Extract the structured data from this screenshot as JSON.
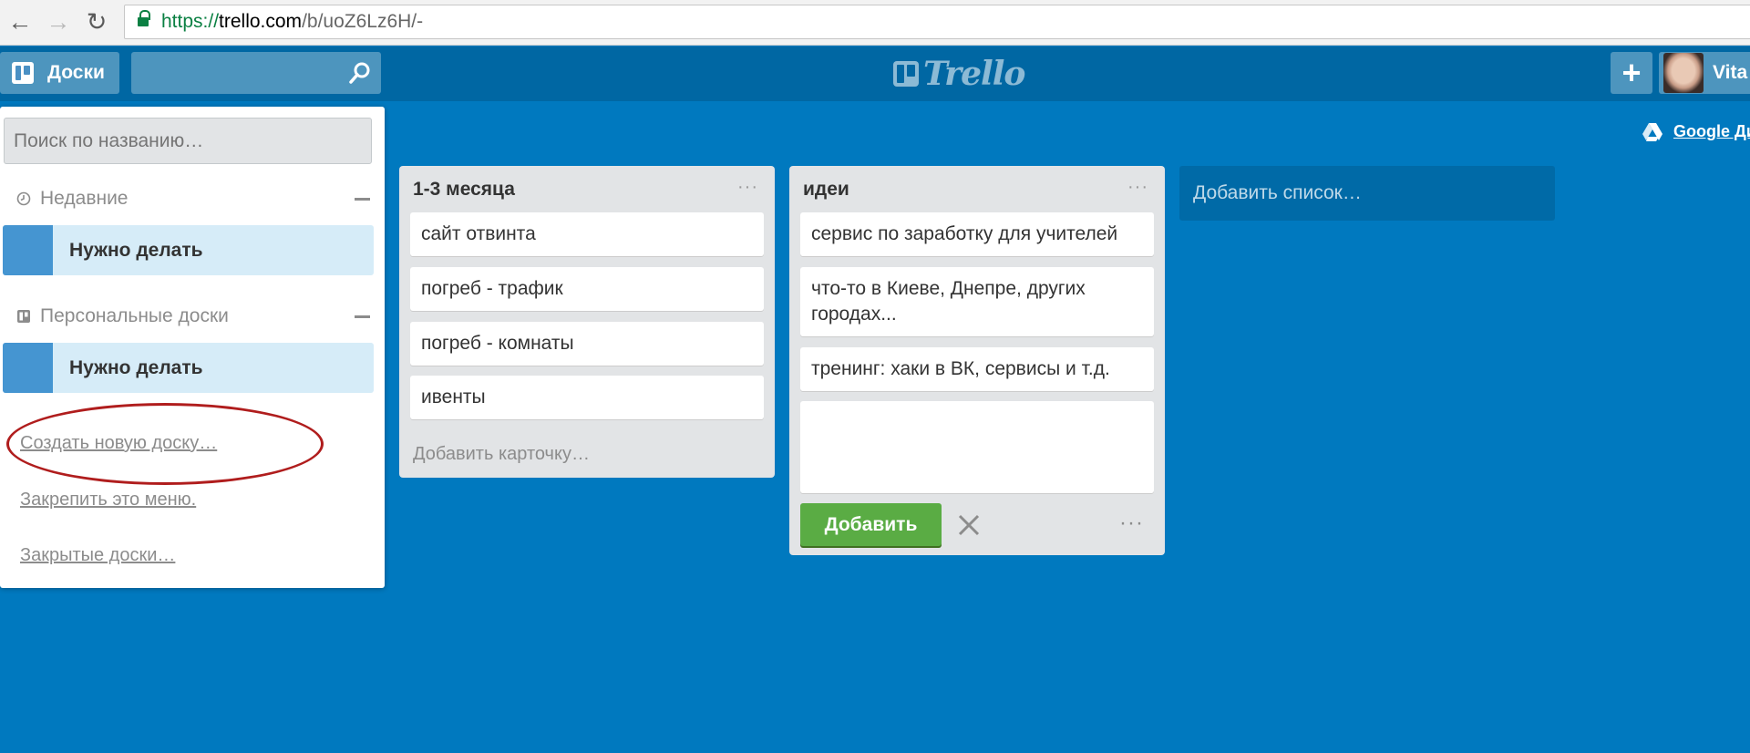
{
  "browser": {
    "url_scheme": "https://",
    "url_host": "trello.com",
    "url_path": "/b/uoZ6Lz6H/-"
  },
  "header": {
    "boards_label": "Доски",
    "logo_text": "Trello",
    "add_label": "+",
    "member_name": "Vita"
  },
  "gdrive_label": "Google Ди",
  "side": {
    "search_placeholder": "Поиск по названию…",
    "recent_title": "Недавние",
    "recent_board": "Нужно делать",
    "personal_title": "Персональные доски",
    "personal_board": "Нужно делать",
    "create_board": "Создать новую доску…",
    "pin_menu": "Закрепить это меню.",
    "closed_boards": "Закрытые доски…"
  },
  "lists": [
    {
      "title": "1-3 месяца",
      "menu": "···",
      "cards": [
        "сайт отвинта",
        "погреб - трафик",
        "погреб - комнаты",
        "ивенты"
      ],
      "add_card": "Добавить карточку…"
    },
    {
      "title": "идеи",
      "menu": "···",
      "cards": [
        "сервис по заработку для учителей",
        "что-то в Киеве, Днепре, других городах...",
        "тренинг: хаки в ВК, сервисы и т.д."
      ],
      "add_button": "Добавить",
      "more": "···"
    }
  ],
  "add_list": "Добавить список…",
  "colors": {
    "board_bg": "#0079bf",
    "header_bg": "#0067a3",
    "save_green": "#5aac44",
    "highlight_red": "#b01d1d"
  }
}
